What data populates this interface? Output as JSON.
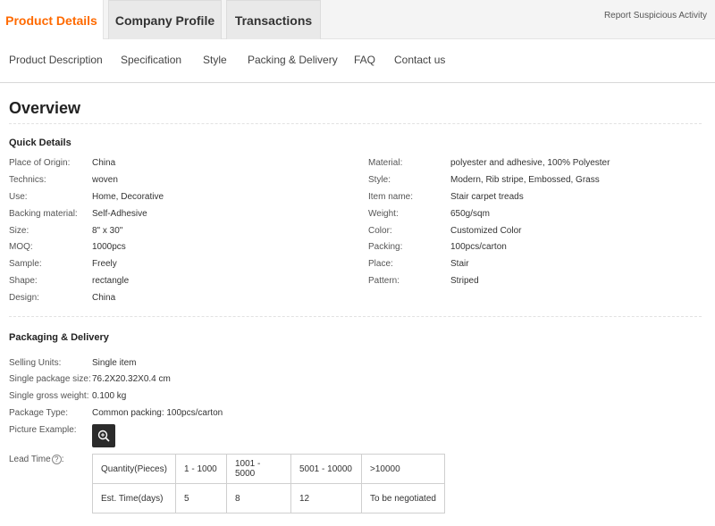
{
  "tabs": {
    "product_details": "Product Details",
    "company_profile": "Company Profile",
    "transactions": "Transactions",
    "report": "Report Suspicious Activity"
  },
  "sub_nav": [
    "Product Description",
    "Specification",
    "Style",
    "Packing & Delivery",
    "FAQ",
    "Contact us"
  ],
  "overview": {
    "title": "Overview",
    "quick_details_title": "Quick Details",
    "left": [
      {
        "label": "Place of Origin:",
        "value": "China"
      },
      {
        "label": "Technics:",
        "value": "woven"
      },
      {
        "label": "Use:",
        "value": "Home, Decorative"
      },
      {
        "label": "Backing material:",
        "value": "Self-Adhesive"
      },
      {
        "label": "Size:",
        "value": "8\" x 30\""
      },
      {
        "label": "MOQ:",
        "value": "1000pcs"
      },
      {
        "label": "Sample:",
        "value": "Freely"
      },
      {
        "label": "Shape:",
        "value": "rectangle"
      },
      {
        "label": "Design:",
        "value": "China"
      }
    ],
    "right": [
      {
        "label": "Material:",
        "value": "polyester and adhesive, 100% Polyester"
      },
      {
        "label": "Style:",
        "value": "Modern, Rib stripe, Embossed, Grass"
      },
      {
        "label": "Item name:",
        "value": "Stair carpet treads"
      },
      {
        "label": "Weight:",
        "value": "650g/sqm"
      },
      {
        "label": "Color:",
        "value": "Customized Color"
      },
      {
        "label": "Packing:",
        "value": "100pcs/carton"
      },
      {
        "label": "Place:",
        "value": "Stair"
      },
      {
        "label": "Pattern:",
        "value": "Striped"
      }
    ]
  },
  "packaging": {
    "title": "Packaging & Delivery",
    "rows": [
      {
        "label": "Selling Units:",
        "value": "Single item"
      },
      {
        "label": "Single package size:",
        "value": "76.2X20.32X0.4 cm"
      },
      {
        "label": "Single gross weight:",
        "value": "0.100 kg"
      },
      {
        "label": "Package Type:",
        "value": "Common packing: 100pcs/carton"
      }
    ],
    "picture_label": "Picture Example:",
    "lead_time_label": "Lead Time",
    "help_glyph": "?",
    "lead_table": [
      [
        "Quantity(Pieces)",
        "1 - 1000",
        "1001 - 5000",
        "5001 - 10000",
        ">10000"
      ],
      [
        "Est. Time(days)",
        "5",
        "8",
        "12",
        "To be negotiated"
      ]
    ]
  }
}
